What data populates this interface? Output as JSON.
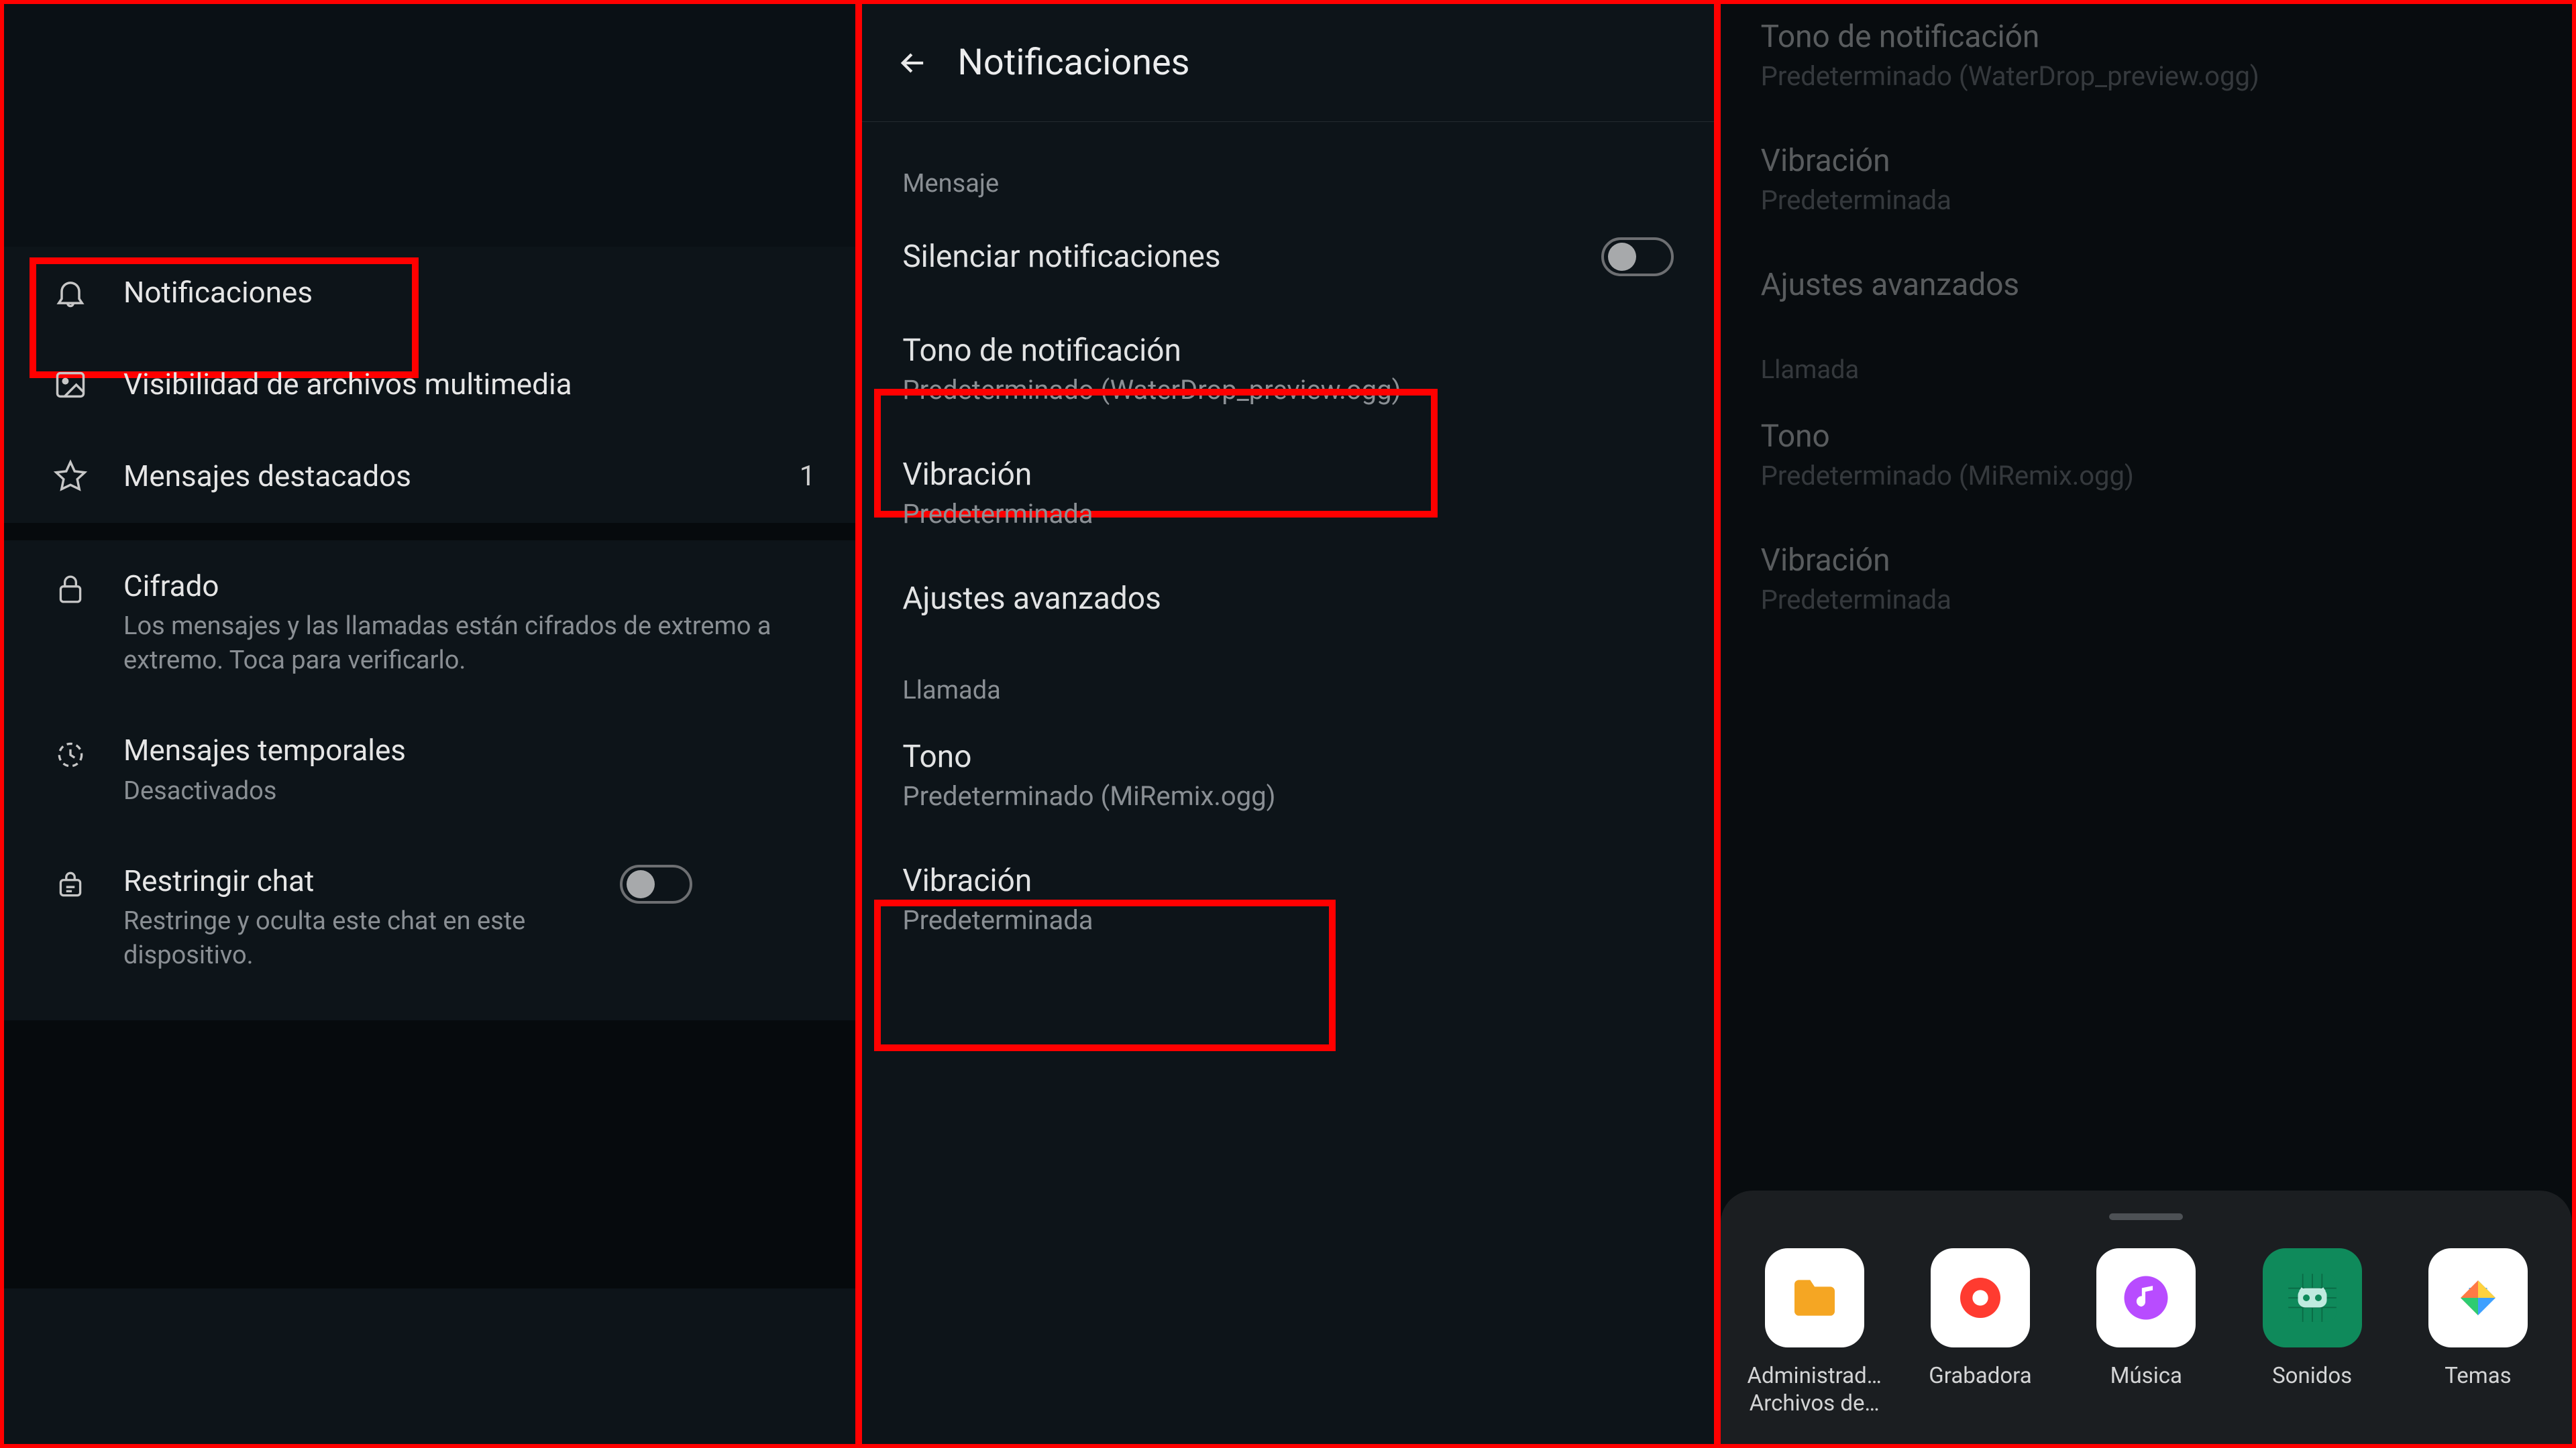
{
  "panel1": {
    "items": [
      {
        "title": "Notificaciones"
      },
      {
        "title": "Visibilidad de archivos multimedia"
      },
      {
        "title": "Mensajes destacados",
        "badge": "1"
      },
      {
        "title": "Cifrado",
        "subtitle": "Los mensajes y las llamadas están cifrados de extremo a extremo. Toca para verificarlo."
      },
      {
        "title": "Mensajes temporales",
        "subtitle": "Desactivados"
      },
      {
        "title": "Restringir chat",
        "subtitle": "Restringe y oculta este chat en este dispositivo."
      }
    ]
  },
  "panel2": {
    "header_title": "Notificaciones",
    "sections": {
      "mensaje_label": "Mensaje",
      "silenciar": "Silenciar notificaciones",
      "tono_notif": {
        "title": "Tono de notificación",
        "subtitle": "Predeterminado (WaterDrop_preview.ogg)"
      },
      "vibracion1": {
        "title": "Vibración",
        "subtitle": "Predeterminada"
      },
      "ajustes": "Ajustes avanzados",
      "llamada_label": "Llamada",
      "tono": {
        "title": "Tono",
        "subtitle": "Predeterminado (MiRemix.ogg)"
      },
      "vibracion2": {
        "title": "Vibración",
        "subtitle": "Predeterminada"
      }
    }
  },
  "panel3": {
    "tono_notif": {
      "title": "Tono de notificación",
      "subtitle": "Predeterminado (WaterDrop_preview.ogg)"
    },
    "vibracion1": {
      "title": "Vibración",
      "subtitle": "Predeterminada"
    },
    "ajustes": "Ajustes avanzados",
    "llamada_label": "Llamada",
    "tono": {
      "title": "Tono",
      "subtitle": "Predeterminado (MiRemix.ogg)"
    },
    "vibracion2": {
      "title": "Vibración",
      "subtitle": "Predeterminada"
    },
    "apps": [
      {
        "label": "Administrad…",
        "label2": "Archivos de…"
      },
      {
        "label": "Grabadora"
      },
      {
        "label": "Música"
      },
      {
        "label": "Sonidos"
      },
      {
        "label": "Temas"
      }
    ]
  }
}
